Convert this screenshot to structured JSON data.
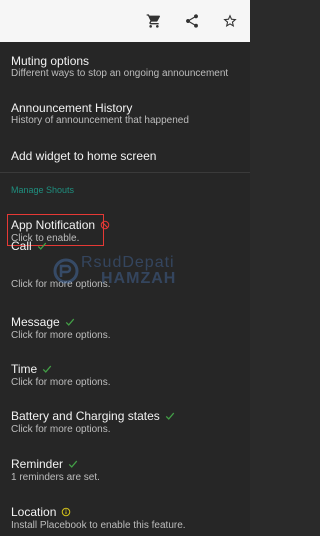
{
  "toolbar": {
    "actions": [
      {
        "icon": "cart-icon"
      },
      {
        "icon": "share-icon"
      },
      {
        "icon": "star-outline-icon"
      }
    ],
    "icon_color": "#333333"
  },
  "settings": {
    "muting_options": {
      "title": "Muting options",
      "subtitle": "Different ways to stop an ongoing announcement"
    },
    "announcement_history": {
      "title": "Announcement History",
      "subtitle": "History of announcement that happened"
    },
    "add_widget": {
      "title": "Add widget to home screen"
    }
  },
  "manage_shouts": {
    "header": "Manage Shouts",
    "header_color": "#1f8f7f",
    "items": [
      {
        "title": "App Notification",
        "subtitle": "Click to enable.",
        "status_icon": "blocked-icon",
        "status_color": "#e53935"
      },
      {
        "title": "Call",
        "subtitle": "Click for more options.",
        "status_icon": "check-icon",
        "status_color": "#43a047"
      },
      {
        "title": "Message",
        "subtitle": "Click for more options.",
        "status_icon": "check-icon",
        "status_color": "#43a047"
      },
      {
        "title": "Time",
        "subtitle": "Click for more options.",
        "status_icon": "check-icon",
        "status_color": "#43a047"
      },
      {
        "title": "Battery and Charging states",
        "subtitle": "Click for more options.",
        "status_icon": "check-icon",
        "status_color": "#43a047"
      },
      {
        "title": "Reminder",
        "subtitle": "1 reminders are set.",
        "status_icon": "check-icon",
        "status_color": "#43a047"
      },
      {
        "title": "Location",
        "subtitle": "Install Placebook to enable this feature.",
        "status_icon": "info-icon",
        "status_color": "#d4c21a"
      }
    ]
  },
  "watermark": {
    "line1": "RsudDepati",
    "line2": "HAMZAH"
  }
}
